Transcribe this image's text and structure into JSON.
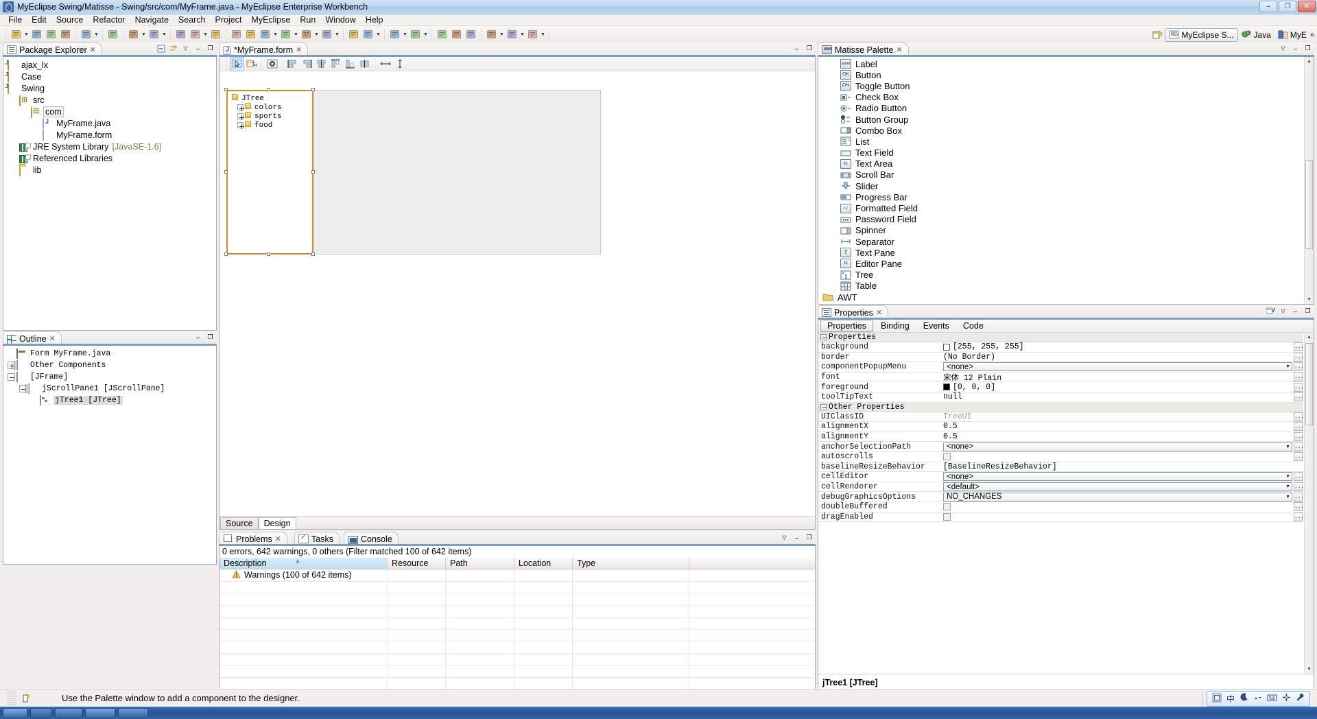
{
  "window": {
    "title": "MyEclipse Swing/Matisse - Swing/src/com/MyFrame.java - MyEclipse Enterprise Workbench",
    "minimize_label": "–",
    "maximize_label": "❐",
    "close_label": "✕"
  },
  "menubar": {
    "items": [
      "File",
      "Edit",
      "Source",
      "Refactor",
      "Navigate",
      "Search",
      "Project",
      "MyEclipse",
      "Run",
      "Window",
      "Help"
    ]
  },
  "perspective_bar": {
    "open_perspective_label": "",
    "items": [
      {
        "label": "MyEclipse S...",
        "active": true
      },
      {
        "label": "Java",
        "active": false
      },
      {
        "label": "MyE",
        "active": false
      }
    ],
    "overflow_label": "»"
  },
  "package_explorer": {
    "tab_label": "Package Explorer",
    "close_label": "✕",
    "collapse_all_label": "⊟",
    "link_editor_label": "⇄",
    "menu_label": "▽",
    "minimize_label": "–",
    "maximize_label": "❐",
    "tree": [
      {
        "label": "ajax_lx",
        "indent": 0,
        "icon": "project-icon",
        "expander": "none"
      },
      {
        "label": "Case",
        "indent": 0,
        "icon": "project-icon",
        "expander": "none"
      },
      {
        "label": "Swing",
        "indent": 0,
        "icon": "project-icon",
        "expander": "none"
      },
      {
        "label": "src",
        "indent": 1,
        "icon": "source-folder-icon",
        "expander": "none"
      },
      {
        "label": "com",
        "indent": 2,
        "icon": "package-icon",
        "expander": "none",
        "selected": true
      },
      {
        "label": "MyFrame.java",
        "indent": 3,
        "icon": "java-file-icon",
        "expander": "none"
      },
      {
        "label": "MyFrame.form",
        "indent": 3,
        "icon": "form-file-icon",
        "expander": "none"
      },
      {
        "label": "JRE System Library",
        "suffix": "[JavaSE-1.6]",
        "indent": 1,
        "icon": "library-icon",
        "expander": "none"
      },
      {
        "label": "Referenced Libraries",
        "indent": 1,
        "icon": "library-icon",
        "expander": "none"
      },
      {
        "label": "lib",
        "indent": 1,
        "icon": "open-folder-icon",
        "expander": "none"
      }
    ]
  },
  "outline": {
    "tab_label": "Outline",
    "close_label": "✕",
    "minimize_label": "–",
    "maximize_label": "❐",
    "tree": [
      {
        "label": "Form MyFrame.java",
        "indent": 0,
        "icon": "form-icon",
        "expander": "none"
      },
      {
        "label": "Other Components",
        "indent": 0,
        "icon": "components-icon",
        "expander": "plus"
      },
      {
        "label": "[JFrame]",
        "indent": 0,
        "icon": "jframe-icon",
        "expander": "minus"
      },
      {
        "label": "jScrollPane1 [JScrollPane]",
        "indent": 1,
        "icon": "scrollpane-icon",
        "expander": "minus"
      },
      {
        "label": "jTree1 [JTree]",
        "indent": 2,
        "icon": "jtree-icon",
        "expander": "none",
        "selected": true
      }
    ]
  },
  "editor": {
    "tab_label": "*MyFrame.form",
    "close_label": "✕",
    "minimize_label": "–",
    "maximize_label": "❐",
    "bottom_tabs": [
      {
        "label": "Source",
        "active": false
      },
      {
        "label": "Design",
        "active": true
      }
    ],
    "designer_tree": [
      {
        "label": "JTree",
        "indent": 0,
        "expander": "none"
      },
      {
        "label": "colors",
        "indent": 1,
        "expander": "plus"
      },
      {
        "label": "sports",
        "indent": 1,
        "expander": "plus"
      },
      {
        "label": "food",
        "indent": 1,
        "expander": "plus"
      }
    ],
    "toolbar_icons": [
      "selection-mode-icon",
      "connection-mode-icon",
      "preview-design-icon",
      "align-left-icon",
      "align-right-icon",
      "align-center-h-icon",
      "align-top-icon",
      "align-bottom-icon",
      "align-center-v-icon",
      "resize-horizontal-icon",
      "resize-vertical-icon"
    ]
  },
  "palette": {
    "tab_label": "Matisse Palette",
    "close_label": "✕",
    "menu_label": "▽",
    "minimize_label": "–",
    "maximize_label": "❐",
    "items": [
      {
        "label": "Label",
        "icon": "label-icon",
        "glyph": "label"
      },
      {
        "label": "Button",
        "icon": "button-icon",
        "glyph": "OK"
      },
      {
        "label": "Toggle Button",
        "icon": "toggle-button-icon",
        "glyph": "ON"
      },
      {
        "label": "Check Box",
        "icon": "check-box-icon",
        "glyph": ""
      },
      {
        "label": "Radio Button",
        "icon": "radio-button-icon",
        "glyph": ""
      },
      {
        "label": "Button Group",
        "icon": "button-group-icon",
        "glyph": ""
      },
      {
        "label": "Combo Box",
        "icon": "combo-box-icon",
        "glyph": ""
      },
      {
        "label": "List",
        "icon": "list-icon",
        "glyph": ""
      },
      {
        "label": "Text Field",
        "icon": "text-field-icon",
        "glyph": ""
      },
      {
        "label": "Text Area",
        "icon": "text-area-icon",
        "glyph": "tx"
      },
      {
        "label": "Scroll Bar",
        "icon": "scroll-bar-icon",
        "glyph": ""
      },
      {
        "label": "Slider",
        "icon": "slider-icon",
        "glyph": ""
      },
      {
        "label": "Progress Bar",
        "icon": "progress-bar-icon",
        "glyph": ""
      },
      {
        "label": "Formatted Field",
        "icon": "formatted-field-icon",
        "glyph": "/-/"
      },
      {
        "label": "Password Field",
        "icon": "password-field-icon",
        "glyph": "⋯"
      },
      {
        "label": "Spinner",
        "icon": "spinner-icon",
        "glyph": ""
      },
      {
        "label": "Separator",
        "icon": "separator-icon",
        "glyph": ""
      },
      {
        "label": "Text Pane",
        "icon": "text-pane-icon",
        "glyph": "T"
      },
      {
        "label": "Editor Pane",
        "icon": "editor-pane-icon",
        "glyph": "tx"
      },
      {
        "label": "Tree",
        "icon": "tree-icon",
        "glyph": ""
      },
      {
        "label": "Table",
        "icon": "table-icon",
        "glyph": ""
      },
      {
        "label": "AWT",
        "icon": "awt-folder-icon",
        "glyph": "",
        "is_group": true
      }
    ]
  },
  "properties": {
    "tab_label": "Properties",
    "close_label": "✕",
    "pin_label": "",
    "menu_label": "▽",
    "minimize_label": "–",
    "maximize_label": "❐",
    "tabs": [
      {
        "label": "Properties",
        "active": true
      },
      {
        "label": "Binding",
        "active": false
      },
      {
        "label": "Events",
        "active": false
      },
      {
        "label": "Code",
        "active": false
      }
    ],
    "groups": [
      {
        "title": "Properties",
        "rows": [
          {
            "name": "background",
            "value": "[255, 255, 255]",
            "kind": "color",
            "color": "#ffffff",
            "button": "..."
          },
          {
            "name": "border",
            "value": "(No Border)",
            "kind": "text",
            "button": "..."
          },
          {
            "name": "componentPopupMenu",
            "value": "<none>",
            "kind": "combo",
            "button": "..."
          },
          {
            "name": "font",
            "value": "宋体 12 Plain",
            "kind": "text",
            "button": "..."
          },
          {
            "name": "foreground",
            "value": "[0, 0, 0]",
            "kind": "color",
            "color": "#000000",
            "button": "..."
          },
          {
            "name": "toolTipText",
            "value": "null",
            "kind": "text",
            "button": "..."
          }
        ]
      },
      {
        "title": "Other Properties",
        "rows": [
          {
            "name": "UIClassID",
            "value": "TreeUI",
            "kind": "text-disabled",
            "button": "..."
          },
          {
            "name": "alignmentX",
            "value": "0.5",
            "kind": "text",
            "button": "..."
          },
          {
            "name": "alignmentY",
            "value": "0.5",
            "kind": "text",
            "button": "..."
          },
          {
            "name": "anchorSelectionPath",
            "value": "<none>",
            "kind": "combo",
            "button": "..."
          },
          {
            "name": "autoscrolls",
            "value": "",
            "kind": "checkbox",
            "button": "..."
          },
          {
            "name": "baselineResizeBehavior",
            "value": "[BaselineResizeBehavior]",
            "kind": "text",
            "button": ""
          },
          {
            "name": "cellEditor",
            "value": "<none>",
            "kind": "combo",
            "button": "..."
          },
          {
            "name": "cellRenderer",
            "value": "<default>",
            "kind": "combo",
            "button": "..."
          },
          {
            "name": "debugGraphicsOptions",
            "value": "NO_CHANGES",
            "kind": "combo",
            "button": "..."
          },
          {
            "name": "doubleBuffered",
            "value": "",
            "kind": "checkbox",
            "button": "..."
          },
          {
            "name": "dragEnabled",
            "value": "",
            "kind": "checkbox",
            "button": "..."
          }
        ]
      }
    ],
    "selected_component": "jTree1 [JTree]"
  },
  "problems": {
    "tabs": [
      {
        "label": "Problems",
        "icon": "problems-icon",
        "active": true,
        "close_label": "✕"
      },
      {
        "label": "Tasks",
        "icon": "tasks-icon",
        "active": false
      },
      {
        "label": "Console",
        "icon": "console-icon",
        "active": false
      }
    ],
    "summary": "0 errors, 642 warnings, 0 others (Filter matched 100 of 642 items)",
    "columns": [
      "Description",
      "Resource",
      "Path",
      "Location",
      "Type"
    ],
    "rows": [
      {
        "description": "Warnings (100 of 642 items)",
        "resource": "",
        "path": "",
        "location": "",
        "type": "",
        "icon": "warning-icon"
      }
    ],
    "menu_label": "▽",
    "minimize_label": "–",
    "maximize_label": "❐"
  },
  "statusbar": {
    "message": "Use the Palette window to add a component to the designer.",
    "icon": "insert-mode-icon"
  },
  "ime_bar": {
    "items": [
      "ime-icon",
      "中",
      "moon-icon",
      "punctuation-icon",
      "keyboard-icon",
      "toolbox-icon",
      "wrench-icon"
    ]
  },
  "colors": {
    "accent": "#7e9db8",
    "selection_orange": "#d98a27",
    "title_gradient_top": "#d2e4f6",
    "taskbar": "#2c5896"
  }
}
